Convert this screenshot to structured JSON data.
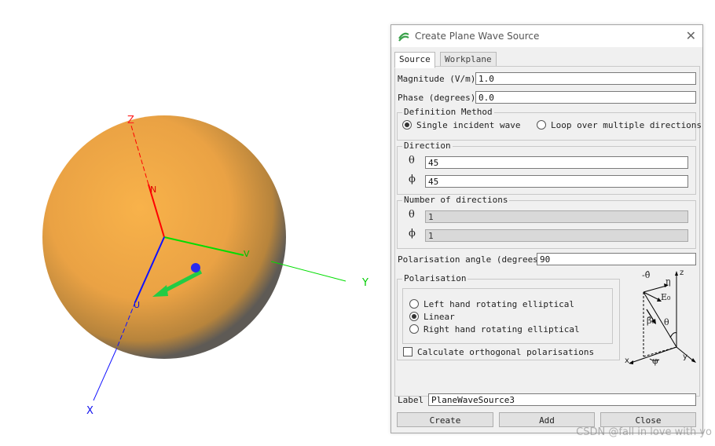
{
  "viewport": {
    "axis_labels": {
      "z": "Z",
      "y": "Y",
      "x": "X"
    },
    "sphere_labels": {
      "n": "N",
      "v": "V",
      "u": "U"
    },
    "colors": {
      "sphere": "#f7ae45",
      "z_axis": "#ff0000",
      "y_axis": "#00dd00",
      "x_axis": "#1010ff",
      "arrow": "#22cc44"
    }
  },
  "dialog": {
    "title": "Create Plane Wave Source",
    "tabs": [
      {
        "label": "Source",
        "active": true
      },
      {
        "label": "Workplane",
        "active": false
      }
    ],
    "magnitude": {
      "label": "Magnitude (V/m)",
      "value": "1.0"
    },
    "phase": {
      "label": "Phase (degrees)",
      "value": "0.0"
    },
    "definition_method": {
      "legend": "Definition Method",
      "options": [
        {
          "label": "Single incident wave",
          "selected": true
        },
        {
          "label": "Loop over multiple directions",
          "selected": false
        }
      ]
    },
    "direction": {
      "legend": "Direction",
      "theta_symbol": "θ",
      "theta": "45",
      "phi_symbol": "ϕ",
      "phi": "45"
    },
    "num_directions": {
      "legend": "Number of directions",
      "theta_symbol": "θ",
      "theta": "1",
      "phi_symbol": "ϕ",
      "phi": "1"
    },
    "polarisation_angle": {
      "label": "Polarisation angle (degrees)",
      "value": "90"
    },
    "polarisation": {
      "legend": "Polarisation",
      "options": [
        {
          "label": "Left hand rotating elliptical",
          "selected": false
        },
        {
          "label": "Linear",
          "selected": true
        },
        {
          "label": "Right hand rotating elliptical",
          "selected": false
        }
      ],
      "orthogonal": {
        "label": "Calculate orthogonal polarisations",
        "checked": false
      }
    },
    "diagram": {
      "z": "z",
      "y": "y",
      "x": "x",
      "theta_hat": "-θ̂",
      "eta": "η",
      "E0": "E₀",
      "beta0": "β̂₀",
      "theta": "θ",
      "phi": "φ"
    },
    "label": {
      "label": "Label",
      "value": "PlaneWaveSource3"
    },
    "buttons": {
      "create": "Create",
      "add": "Add",
      "close": "Close"
    }
  },
  "watermark": "CSDN @fall in love with yo"
}
